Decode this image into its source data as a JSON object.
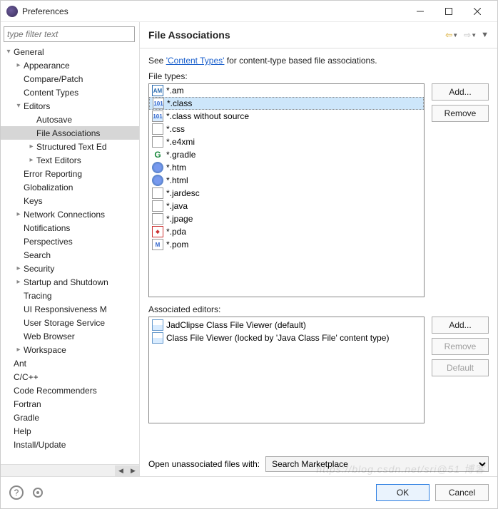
{
  "window": {
    "title": "Preferences"
  },
  "filter": {
    "placeholder": "type filter text"
  },
  "tree": [
    {
      "l": 0,
      "t": "▾",
      "label": "General"
    },
    {
      "l": 1,
      "t": "▸",
      "label": "Appearance"
    },
    {
      "l": 1,
      "t": "",
      "label": "Compare/Patch"
    },
    {
      "l": 1,
      "t": "",
      "label": "Content Types"
    },
    {
      "l": 1,
      "t": "▾",
      "label": "Editors"
    },
    {
      "l": 2,
      "t": "",
      "label": "Autosave"
    },
    {
      "l": 2,
      "t": "",
      "label": "File Associations",
      "selected": true
    },
    {
      "l": 2,
      "t": "▸",
      "label": "Structured Text Ed"
    },
    {
      "l": 2,
      "t": "▸",
      "label": "Text Editors"
    },
    {
      "l": 1,
      "t": "",
      "label": "Error Reporting"
    },
    {
      "l": 1,
      "t": "",
      "label": "Globalization"
    },
    {
      "l": 1,
      "t": "",
      "label": "Keys"
    },
    {
      "l": 1,
      "t": "▸",
      "label": "Network Connections"
    },
    {
      "l": 1,
      "t": "",
      "label": "Notifications"
    },
    {
      "l": 1,
      "t": "",
      "label": "Perspectives"
    },
    {
      "l": 1,
      "t": "",
      "label": "Search"
    },
    {
      "l": 1,
      "t": "▸",
      "label": "Security"
    },
    {
      "l": 1,
      "t": "▸",
      "label": "Startup and Shutdown"
    },
    {
      "l": 1,
      "t": "",
      "label": "Tracing"
    },
    {
      "l": 1,
      "t": "",
      "label": "UI Responsiveness M"
    },
    {
      "l": 1,
      "t": "",
      "label": "User Storage Service"
    },
    {
      "l": 1,
      "t": "",
      "label": "Web Browser"
    },
    {
      "l": 1,
      "t": "▸",
      "label": "Workspace"
    },
    {
      "l": 0,
      "t": "",
      "label": "Ant"
    },
    {
      "l": 0,
      "t": "",
      "label": "C/C++"
    },
    {
      "l": 0,
      "t": "",
      "label": "Code Recommenders"
    },
    {
      "l": 0,
      "t": "",
      "label": "Fortran"
    },
    {
      "l": 0,
      "t": "",
      "label": "Gradle"
    },
    {
      "l": 0,
      "t": "",
      "label": "Help"
    },
    {
      "l": 0,
      "t": "",
      "label": "Install/Update"
    }
  ],
  "page": {
    "title": "File Associations",
    "intro_pre": "See ",
    "intro_link": "'Content Types'",
    "intro_post": " for content-type based file associations.",
    "filetypes_label": "File types:",
    "assoc_label": "Associated editors:",
    "open_label": "Open unassociated files with:",
    "open_value": "Search Marketplace"
  },
  "filetypes": [
    {
      "icon": "am",
      "label": "*.am"
    },
    {
      "icon": "bin",
      "label": "*.class",
      "selected": true
    },
    {
      "icon": "bin",
      "label": "*.class without source"
    },
    {
      "icon": "css",
      "label": "*.css"
    },
    {
      "icon": "j",
      "label": "*.e4xmi"
    },
    {
      "icon": "g",
      "label": "*.gradle"
    },
    {
      "icon": "globe",
      "label": "*.htm"
    },
    {
      "icon": "globe",
      "label": "*.html"
    },
    {
      "icon": "j",
      "label": "*.jardesc"
    },
    {
      "icon": "j",
      "label": "*.java"
    },
    {
      "icon": "j",
      "label": "*.jpage"
    },
    {
      "icon": "pda",
      "label": "*.pda"
    },
    {
      "icon": "m",
      "label": "*.pom"
    }
  ],
  "buttons": {
    "add": "Add...",
    "remove": "Remove",
    "default": "Default"
  },
  "editors": [
    {
      "label": "JadClipse Class File Viewer (default)"
    },
    {
      "label": "Class File Viewer (locked by 'Java Class File' content type)"
    }
  ],
  "footer": {
    "ok": "OK",
    "cancel": "Cancel"
  },
  "watermark": "https://blog.csdn.net/sri@51 博客"
}
